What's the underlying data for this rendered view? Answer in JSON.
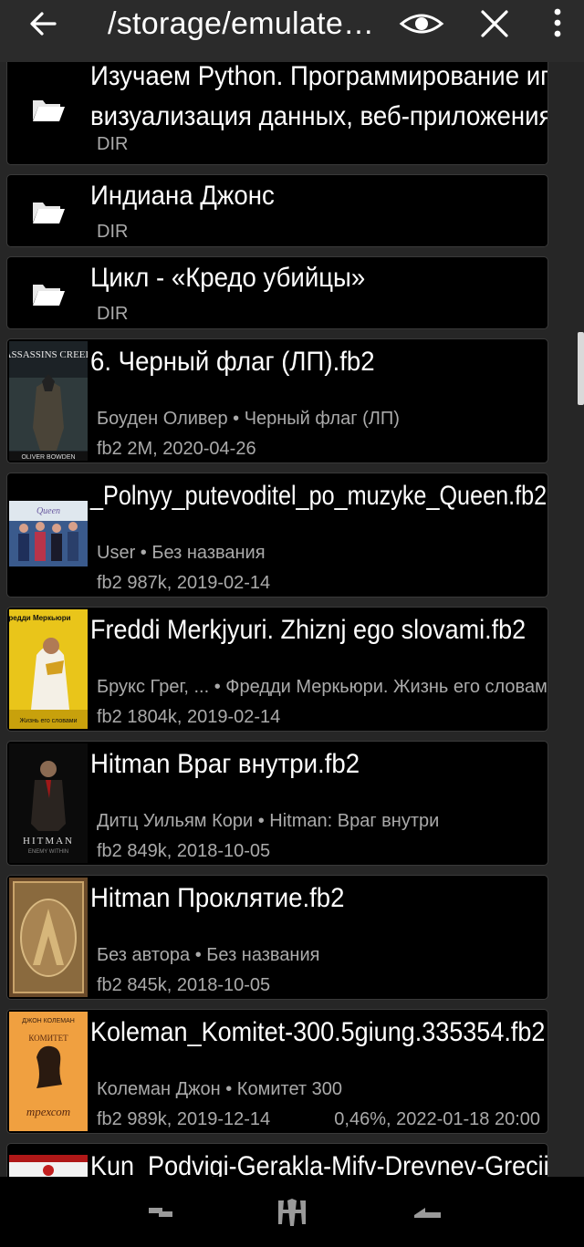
{
  "toolbar": {
    "back_icon": "arrow-left-icon",
    "path": "/storage/emulate…",
    "view_icon": "eye-icon",
    "close_icon": "close-icon",
    "menu_icon": "more-vert-icon"
  },
  "files": [
    {
      "type": "dir",
      "name_line1": "Изучаем Python. Программирование игр,",
      "name_line2": "визуализация данных, веб-приложения",
      "dir_label": "DIR"
    },
    {
      "type": "dir",
      "name_line1": "Индиана Джонс",
      "dir_label": "DIR"
    },
    {
      "type": "dir",
      "name_line1": "Цикл - «Кредо убийцы»",
      "dir_label": "DIR"
    },
    {
      "type": "book",
      "name_line1": "6. Черный флаг (ЛП).fb2",
      "author_title": "Боуден Оливер • Черный флаг (ЛП)",
      "info": "fb2  2M, 2020-04-26",
      "progress": "",
      "cover_text": "ASSASSINS CREED",
      "cover_sub": "OLIVER BOWDEN"
    },
    {
      "type": "book",
      "name_line1": "_Polnyy_putevoditel_po_muzyke_Queen.fb2",
      "author_title": "User • Без названия",
      "info": "fb2  987k, 2019-02-14",
      "progress": "",
      "cover_text": "Queen"
    },
    {
      "type": "book",
      "name_line1": "Freddi Merkjyuri. Zhiznj ego slovami.fb2",
      "author_title": "Брукс Грег, ... • Фредди Меркьюри. Жизнь его словами",
      "info": "fb2  1804k, 2019-02-14",
      "progress": "",
      "cover_text": "Фредди Меркьюри",
      "cover_sub": "Жизнь его словами"
    },
    {
      "type": "book",
      "name_line1": "Hitman Враг внутри.fb2",
      "author_title": "Дитц Уильям Кори • Hitman: Враг внутри",
      "info": "fb2  849k, 2018-10-05",
      "progress": "",
      "cover_text": "HITMAN",
      "cover_sub": "ENEMY WITHIN"
    },
    {
      "type": "book",
      "name_line1": "Hitman Проклятие.fb2",
      "author_title": "Без автора • Без названия",
      "info": "fb2  845k, 2018-10-05",
      "progress": ""
    },
    {
      "type": "book",
      "name_line1": "Koleman_Komitet-300.5giung.335354.fb2",
      "author_title": "Колеман Джон • Комитет 300",
      "info": "fb2  989k, 2019-12-14",
      "progress": "0,46%, 2022-01-18 20:00",
      "cover_text": "ДЖОН КОЛЕМАН",
      "cover_sub": "КОМИТЕТ",
      "cover_sub2": "трехсот"
    },
    {
      "type": "book",
      "name_line1": "Kun_Podvigi-Gerakla-Mifv-Drevnev-Grecii."
    }
  ],
  "navbar": {
    "recent_icon": "recent-apps-icon",
    "home_icon": "home-logo-icon",
    "back_icon": "nav-back-icon"
  },
  "colors": {
    "background": "#262626",
    "card": "#000000",
    "text": "#ffffff",
    "secondary": "#aaaaaa",
    "toolbar": "#2b2b2b"
  }
}
